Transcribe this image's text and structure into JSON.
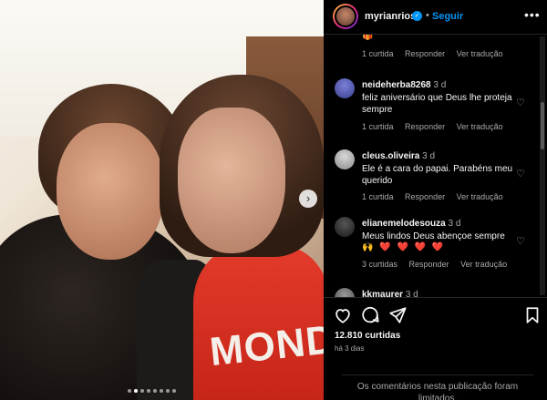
{
  "header": {
    "username": "myrianrios",
    "verified_icon": "verified-badge-icon",
    "separator": "•",
    "follow_label": "Seguir",
    "more_icon": "more-options-icon"
  },
  "photo": {
    "shirt_text": "MOND",
    "next_icon": "chevron-right-icon",
    "carousel_dots": 8,
    "carousel_active_index": 1
  },
  "comments": [
    {
      "user": "",
      "time": "",
      "text": "",
      "emoji": "🎁",
      "likes_label": "1 curtida",
      "reply_label": "Responder",
      "translate_label": "Ver tradução"
    },
    {
      "user": "neideherba8268",
      "time": "3 d",
      "text": "feliz aniversário que Deus lhe proteja sempre",
      "likes_label": "1 curtida",
      "reply_label": "Responder",
      "translate_label": "Ver tradução"
    },
    {
      "user": "cleus.oliveira",
      "time": "3 d",
      "text": "Ele é a cara do papai. Parabéns meu querido",
      "likes_label": "1 curtida",
      "reply_label": "Responder",
      "translate_label": "Ver tradução"
    },
    {
      "user": "elianemelodesouza",
      "time": "3 d",
      "text": "Meus lindos Deus abençoe sempre",
      "emoji": "🙌 ❤️ ❤️ ❤️ ❤️",
      "likes_label": "3 curtidas",
      "reply_label": "Responder",
      "translate_label": "Ver tradução"
    },
    {
      "user": "kkmaurer",
      "time": "3 d",
      "text": ""
    }
  ],
  "footer": {
    "likes_count": "12.810 curtidas",
    "time_ago": "há 3 dias",
    "comments_limited": "Os comentários nesta publicação foram limitados."
  },
  "colors": {
    "accent": "#0095f6",
    "background": "#000000",
    "text": "#f5f5f5",
    "muted": "#a8a8a8",
    "heart_red": "#ed4956"
  }
}
